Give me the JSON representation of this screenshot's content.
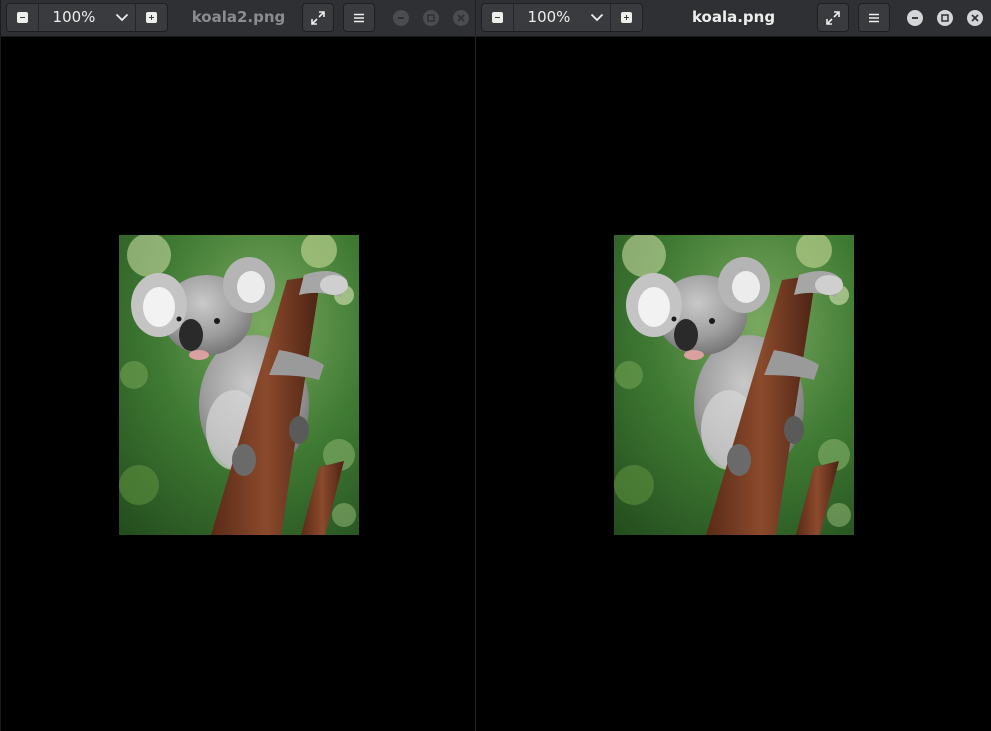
{
  "windows": [
    {
      "id": "left",
      "zoom_value": "100%",
      "title": "koala2.png",
      "focused": false,
      "image_label": "koala"
    },
    {
      "id": "right",
      "zoom_value": "100%",
      "title": "koala.png",
      "focused": true,
      "image_label": "koala"
    }
  ],
  "colors": {
    "headerbar": "#2e3033",
    "button": "#393b3f",
    "text_active": "#eeeeec",
    "text_inactive": "#8a8c8e",
    "canvas": "#000000"
  },
  "icons": {
    "zoom_out": "minus-icon",
    "zoom_menu": "chevron-down-icon",
    "zoom_in": "plus-icon",
    "fullscreen": "expand-icon",
    "menu": "hamburger-icon",
    "minimize": "minimize-icon",
    "maximize": "maximize-icon",
    "close": "close-icon"
  }
}
